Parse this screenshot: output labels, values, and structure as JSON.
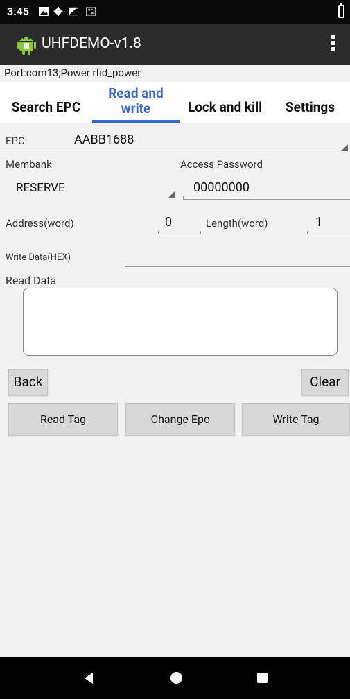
{
  "status_bar": {
    "time": "3:45",
    "icons": [
      "image-icon",
      "gear-icon",
      "photo-icon",
      "qr-icon",
      "battery-icon"
    ]
  },
  "app": {
    "title": "UHFDEMO-v1.8",
    "icon": "android-icon"
  },
  "info_line": "Port:com13;Power:rfid_power",
  "tabs": [
    {
      "label": "Search EPC",
      "active": false
    },
    {
      "label": "Read and write",
      "active": true
    },
    {
      "label": "Lock and kill",
      "active": false
    },
    {
      "label": "Settings",
      "active": false
    }
  ],
  "form": {
    "epc_label": "EPC:",
    "epc_value": "AABB1688",
    "membank_label": "Membank",
    "membank_value": "RESERVE",
    "access_password_label": "Access Password",
    "access_password_value": "00000000",
    "address_label": "Address(word)",
    "address_value": "0",
    "length_label": "Length(word)",
    "length_value": "1",
    "write_data_label": "Write Data(HEX)",
    "write_data_value": "",
    "read_data_label": "Read Data",
    "read_data_value": ""
  },
  "buttons": {
    "back": "Back",
    "clear": "Clear",
    "read_tag": "Read Tag",
    "change_epc": "Change Epc",
    "write_tag": "Write Tag"
  },
  "colors": {
    "accent": "#3a66c8",
    "status_bar": "#0a0a0a",
    "action_bar": "#2b2b2b",
    "button": "#d8d8d8"
  }
}
